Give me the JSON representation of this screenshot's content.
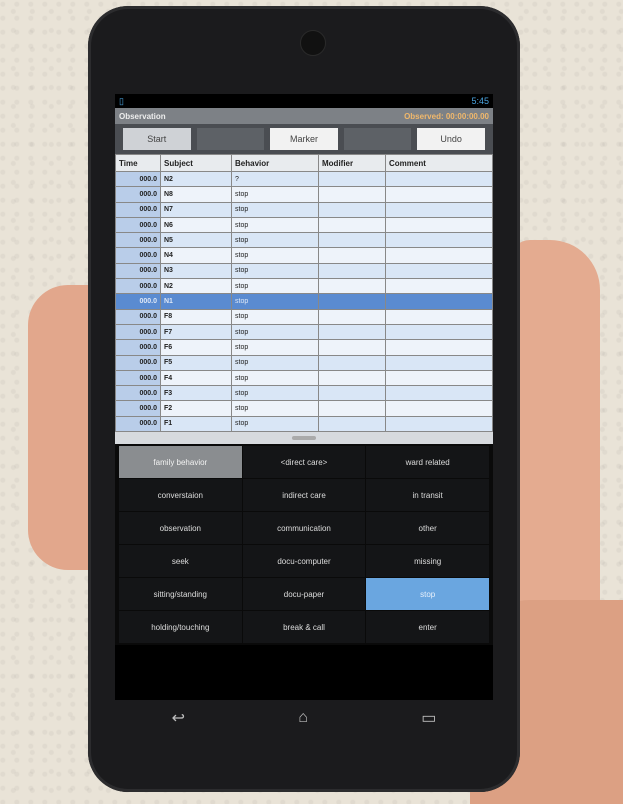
{
  "status": {
    "time": "5:45"
  },
  "title": {
    "app": "Observation",
    "observed": "Observed: 00:00:00.00"
  },
  "toolbar": {
    "buttons": [
      "Start",
      "",
      "Marker",
      "",
      "Undo"
    ]
  },
  "table": {
    "headers": [
      "Time",
      "Subject",
      "Behavior",
      "Modifier",
      "Comment"
    ],
    "rows": [
      {
        "time": "000.0",
        "subject": "N2",
        "behavior": "?"
      },
      {
        "time": "000.0",
        "subject": "N8",
        "behavior": "stop"
      },
      {
        "time": "000.0",
        "subject": "N7",
        "behavior": "stop"
      },
      {
        "time": "000.0",
        "subject": "N6",
        "behavior": "stop"
      },
      {
        "time": "000.0",
        "subject": "N5",
        "behavior": "stop"
      },
      {
        "time": "000.0",
        "subject": "N4",
        "behavior": "stop"
      },
      {
        "time": "000.0",
        "subject": "N3",
        "behavior": "stop"
      },
      {
        "time": "000.0",
        "subject": "N2",
        "behavior": "stop"
      },
      {
        "time": "000.0",
        "subject": "N1",
        "behavior": "stop"
      },
      {
        "time": "000.0",
        "subject": "F8",
        "behavior": "stop"
      },
      {
        "time": "000.0",
        "subject": "F7",
        "behavior": "stop"
      },
      {
        "time": "000.0",
        "subject": "F6",
        "behavior": "stop"
      },
      {
        "time": "000.0",
        "subject": "F5",
        "behavior": "stop"
      },
      {
        "time": "000.0",
        "subject": "F4",
        "behavior": "stop"
      },
      {
        "time": "000.0",
        "subject": "F3",
        "behavior": "stop"
      },
      {
        "time": "000.0",
        "subject": "F2",
        "behavior": "stop"
      },
      {
        "time": "000.0",
        "subject": "F1",
        "behavior": "stop"
      }
    ],
    "selected_index": 8
  },
  "behaviors": [
    "family behavior",
    "<direct care>",
    "ward related",
    "converstaion",
    "indirect care",
    "in transit",
    "observation",
    "communication",
    "other",
    "seek",
    "docu-computer",
    "missing",
    "sitting/standing",
    "docu-paper",
    "stop",
    "holding/touching",
    "break & call",
    "enter"
  ],
  "colors": {
    "selected_gray": "#8a8d90",
    "selected_blue": "#6aa6e0",
    "row_selected": "#5a8bd1"
  }
}
